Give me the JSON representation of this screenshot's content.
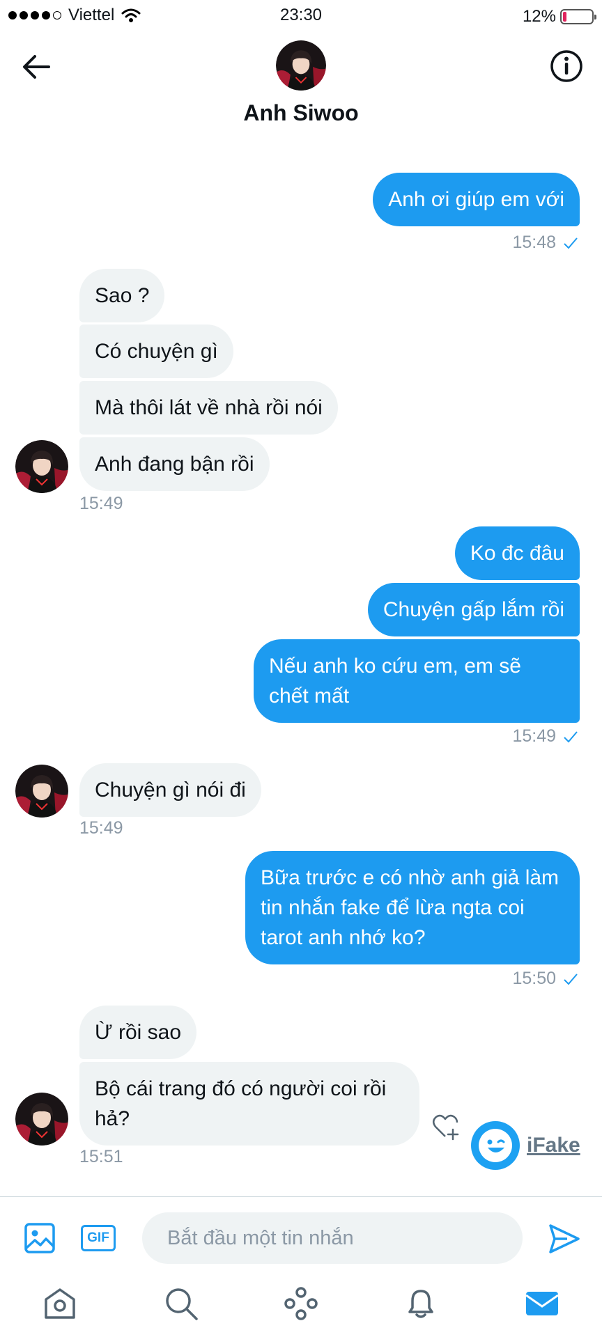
{
  "status_bar": {
    "carrier": "Viettel",
    "time": "23:30",
    "battery_text": "12%",
    "battery_level": 0.12
  },
  "header": {
    "contact_name": "Anh Siwoo"
  },
  "messages": [
    {
      "text": "Anh ơi giúp em với",
      "direction": "out"
    },
    {
      "text": "15:48"
    },
    {
      "text": "Sao ?",
      "direction": "in"
    },
    {
      "text": "Có chuyện gì",
      "direction": "in"
    },
    {
      "text": "Mà thôi lát về nhà rồi nói",
      "direction": "in"
    },
    {
      "text": "Anh đang bận rồi",
      "direction": "in"
    },
    {
      "text": "15:49"
    },
    {
      "text": "Ko đc đâu",
      "direction": "out"
    },
    {
      "text": "Chuyện gấp lắm rồi",
      "direction": "out"
    },
    {
      "text": "Nếu anh ko cứu em, em sẽ chết mất",
      "direction": "out"
    },
    {
      "text": "15:49"
    },
    {
      "text": "Chuyện gì nói đi",
      "direction": "in"
    },
    {
      "text": "15:49"
    },
    {
      "text": "Bữa trước e có nhờ anh giả làm tin nhắn fake để lừa ngta coi tarot anh nhớ ko?",
      "direction": "out"
    },
    {
      "text": "15:50"
    },
    {
      "text": "Ừ rồi sao",
      "direction": "in"
    },
    {
      "text": "Bộ cái trang đó có người coi rồi hả?",
      "direction": "in"
    },
    {
      "text": "15:51"
    }
  ],
  "watermark": {
    "text": "iFake"
  },
  "composer": {
    "placeholder": "Bắt đầu một tin nhắn",
    "gif_label": "GIF"
  },
  "colors": {
    "accent": "#1d9bf0",
    "incoming_bubble": "#eff3f4",
    "muted": "#8b98a5"
  },
  "icons": [
    "back-arrow-icon",
    "info-icon",
    "image-icon",
    "gif-icon",
    "send-icon",
    "home-icon",
    "search-icon",
    "spaces-icon",
    "bell-icon",
    "mail-icon",
    "heart-plus-icon",
    "check-icon",
    "wifi-icon"
  ]
}
